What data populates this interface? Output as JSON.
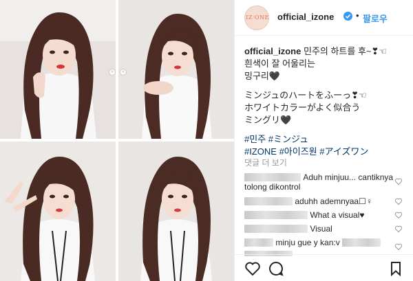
{
  "post": {
    "username": "official_izone",
    "follow_label": "팔로우",
    "separator": "•",
    "avatar_text": "IZ·ONE"
  },
  "caption": {
    "user": "official_izone",
    "lines": [
      "민주의 하트를 후~❣☜",
      "흰색이 잘 어울리는",
      "밍구리🖤"
    ],
    "jp_lines": [
      "ミンジュのハートをふーっ❣☜",
      "ホワイトカラーがよく似合う",
      "ミングリ🖤"
    ],
    "tags_line1": "#민주 #ミンジュ",
    "tags_line2": "#IZONE #아이즈원 #アイズワン"
  },
  "comments": {
    "view_more": "댓글 더 보기",
    "items": [
      {
        "text": "Aduh minjuu... cantiknya",
        "text2": "tolong dikontrol"
      },
      {
        "text": "aduhh ademnyaa☐♀"
      },
      {
        "text": "What a visual♥"
      },
      {
        "text": "Visual"
      },
      {
        "text": "minju gue y kan:v"
      }
    ]
  },
  "icons": {
    "verified": "verified-badge-icon",
    "heart": "heart-icon",
    "comment": "comment-icon",
    "bookmark": "bookmark-icon",
    "like": "like-icon"
  },
  "colors": {
    "accent": "#3897f0",
    "text": "#262626",
    "muted": "#999999",
    "hashtag": "#003569"
  }
}
